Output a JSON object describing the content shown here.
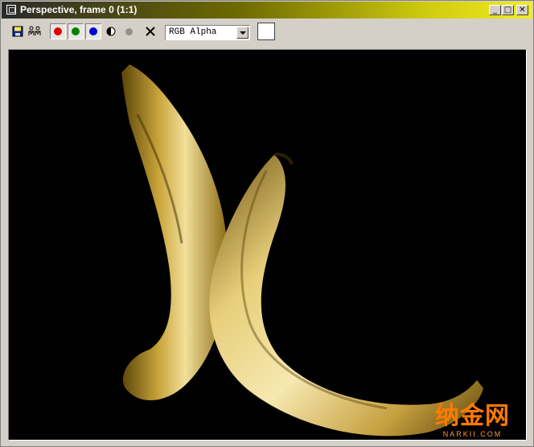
{
  "window": {
    "title": "Perspective, frame 0 (1:1)",
    "controls": {
      "minimize": "_",
      "maximize": "□",
      "close": "✕"
    }
  },
  "toolbar": {
    "buttons": [
      {
        "icon": "save-icon"
      },
      {
        "icon": "clone-icon"
      },
      {
        "icon": "red-channel-icon",
        "color": "#e00000"
      },
      {
        "icon": "green-channel-icon",
        "color": "#008000"
      },
      {
        "icon": "blue-channel-icon",
        "color": "#0000d0"
      },
      {
        "icon": "monochrome-icon"
      },
      {
        "icon": "alpha-channel-icon",
        "color": "#909090"
      },
      {
        "icon": "clear-icon"
      }
    ],
    "channel_select": {
      "value": "RGB Alpha"
    },
    "swatch_color": "#ffffff"
  },
  "viewport": {
    "background": "#000000",
    "content": "bananas-render",
    "watermark": {
      "main": "纳金网",
      "sub": "NARKII.COM"
    }
  }
}
